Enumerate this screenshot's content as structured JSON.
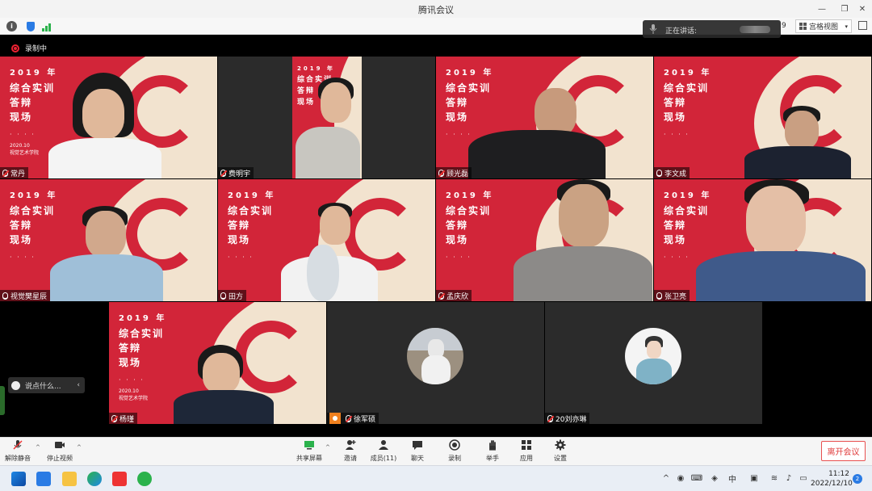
{
  "window": {
    "title": "腾讯会议"
  },
  "topbar": {
    "page_number": "9",
    "view_label": "宫格视图",
    "speaking_label": "正在讲话:"
  },
  "recording": {
    "label": "录制中"
  },
  "participants": [
    {
      "name": "常丹",
      "mic": "muted"
    },
    {
      "name": "费明宇",
      "mic": "muted"
    },
    {
      "name": "顾光磊",
      "mic": "muted"
    },
    {
      "name": "李文成",
      "mic": "on"
    },
    {
      "name": "视觉樊星辰",
      "mic": "on"
    },
    {
      "name": "田方",
      "mic": "on"
    },
    {
      "name": "孟庆欣",
      "mic": "muted"
    },
    {
      "name": "张卫亮",
      "mic": "on"
    },
    {
      "name": "杨瑾",
      "mic": "muted"
    },
    {
      "name": "徐军硕",
      "mic": "muted"
    },
    {
      "name": "20刘亦琳",
      "mic": "muted"
    }
  ],
  "poster": {
    "year": "2019",
    "year_suffix": "年",
    "line1": "综合实训",
    "line2": "答辩",
    "line3": "现场",
    "dots": "· · · ·",
    "small_date": "2020.10",
    "small_org": "视觉艺术学院"
  },
  "chat": {
    "placeholder": "说点什么..."
  },
  "toolbar": {
    "unmute": "解除静音",
    "stop_video": "停止视频",
    "share": "共享屏幕",
    "invite": "邀请",
    "members": "成员(11)",
    "chat": "聊天",
    "record": "录制",
    "raise_hand": "举手",
    "apps": "应用",
    "settings": "设置",
    "leave": "离开会议"
  },
  "taskbar": {
    "time": "11:12",
    "date": "2022/12/10",
    "notifications": "2"
  },
  "colors": {
    "poster_red": "#d22539",
    "poster_cream": "#f2e3cf",
    "leave_red": "#e03c3c",
    "accent_blue": "#2a7be4"
  }
}
